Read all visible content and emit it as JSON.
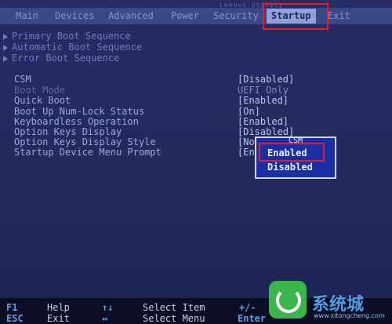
{
  "header": {
    "brand": "Lenovo                 Utility",
    "tabs": [
      {
        "label": "Main"
      },
      {
        "label": "Devices"
      },
      {
        "label": "Advanced"
      },
      {
        "label": "Power"
      },
      {
        "label": "Security"
      },
      {
        "label": "Startup",
        "selected": true
      },
      {
        "label": "Exit"
      }
    ]
  },
  "submenus": [
    {
      "label": "Primary Boot Sequence"
    },
    {
      "label": "Automatic Boot Sequence"
    },
    {
      "label": "Error Boot Sequence"
    }
  ],
  "settings": [
    {
      "label": "CSM",
      "value": "[Disabled]"
    },
    {
      "label": "Boot Mode",
      "value": "UEFI Only"
    },
    {
      "label": "Quick Boot",
      "value": "[Enabled]"
    },
    {
      "label": "Boot Up Num-Lock Status",
      "value": "[On]"
    },
    {
      "label": "Keyboardless Operation",
      "value": "[Enabled]"
    },
    {
      "label": "Option Keys Display",
      "value": "[Disabled]"
    },
    {
      "label": "Option Keys Display Style",
      "value": "[No"
    },
    {
      "label": "Startup Device Menu Prompt",
      "value": "[En"
    }
  ],
  "popup": {
    "title": "CSM",
    "options": [
      "Enabled",
      "Disabled"
    ],
    "selected": "Enabled"
  },
  "footer": {
    "keys": [
      {
        "key": "F1",
        "desc": "Help"
      },
      {
        "key": "ESC",
        "desc": "Exit"
      },
      {
        "key": "↑↓",
        "desc": "Select Item"
      },
      {
        "key": "↔",
        "desc": "Select Menu"
      },
      {
        "key": "+/-",
        "desc": ""
      },
      {
        "key": "Enter",
        "desc": ""
      }
    ]
  },
  "watermark": {
    "text": "系统城",
    "url": "www.xitongcheng.com"
  },
  "colors": {
    "background": "#252b60",
    "highlight_tab": "#8fa1d6",
    "popup": "#1a2ea6",
    "annotation": "#e01f2b"
  }
}
